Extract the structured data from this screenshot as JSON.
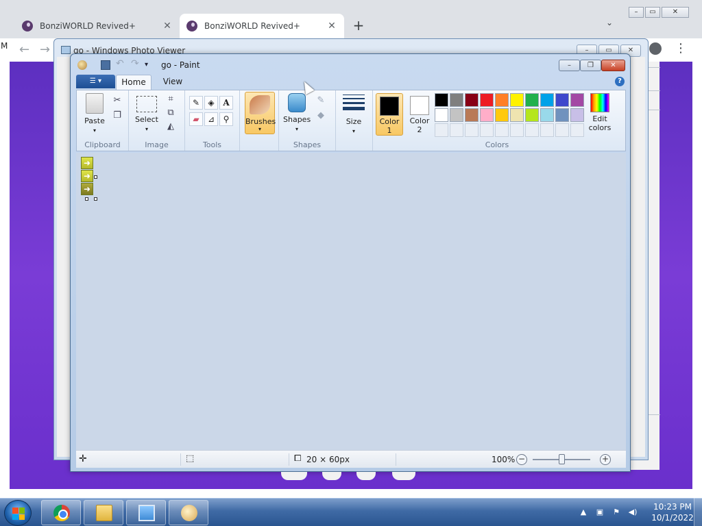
{
  "browser": {
    "tabs": [
      {
        "title": "BonziWORLD Revived+",
        "active": false
      },
      {
        "title": "BonziWORLD Revived+",
        "active": true
      }
    ],
    "new_tab_label": "+",
    "left_edge_text": "M"
  },
  "photo_viewer": {
    "title": "go - Windows Photo Viewer"
  },
  "paint": {
    "title": "go - Paint",
    "tabs": {
      "home": "Home",
      "view": "View"
    },
    "groups": {
      "clipboard": {
        "label": "Clipboard",
        "paste": "Paste"
      },
      "image": {
        "label": "Image",
        "select": "Select"
      },
      "tools": {
        "label": "Tools"
      },
      "brushes": {
        "label": "Brushes"
      },
      "shapes": {
        "label": "Shapes",
        "shapes_btn": "Shapes"
      },
      "size": {
        "label": "Size"
      },
      "colors": {
        "label": "Colors",
        "color1": "Color\n1",
        "color2": "Color\n2",
        "color1_value": "#000000",
        "color2_value": "#ffffff",
        "edit_colors": "Edit\ncolors",
        "palette": [
          "#000000",
          "#7f7f7f",
          "#880015",
          "#ed1c24",
          "#ff7f27",
          "#fff200",
          "#22b14c",
          "#00a2e8",
          "#3f48cc",
          "#a349a4",
          "#ffffff",
          "#c3c3c3",
          "#b97a57",
          "#ffaec9",
          "#ffc90e",
          "#efe4b0",
          "#b5e61d",
          "#99d9ea",
          "#7092be",
          "#c8bfe7",
          "",
          "",
          "",
          "",
          "",
          "",
          "",
          "",
          "",
          ""
        ]
      }
    },
    "status": {
      "dimensions": "20 × 60px",
      "zoom": "100%"
    }
  },
  "taskbar": {
    "time": "10:23 PM",
    "date": "10/1/2022"
  }
}
